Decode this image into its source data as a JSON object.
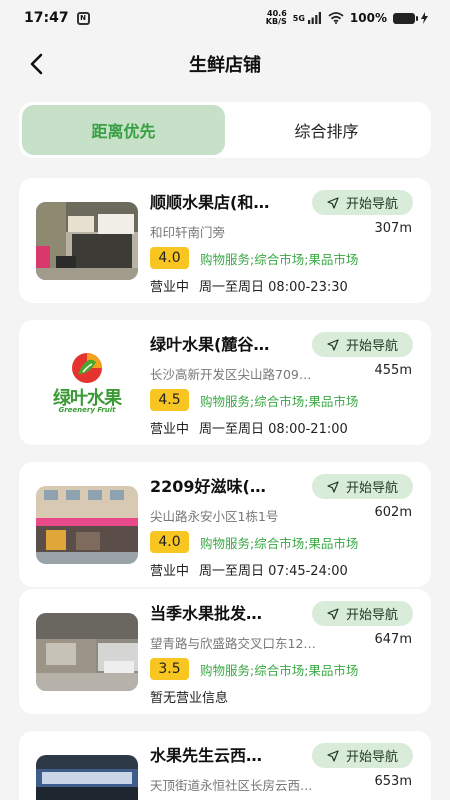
{
  "status_bar": {
    "time": "17:47",
    "net_speed_value": "40.6",
    "net_speed_unit": "KB/S",
    "network": "5G",
    "battery": "100%"
  },
  "header": {
    "title": "生鲜店铺"
  },
  "tabs": [
    {
      "label": "距离优先",
      "active": true
    },
    {
      "label": "综合排序",
      "active": false
    }
  ],
  "nav_label": "开始导航",
  "shops": [
    {
      "name": "顺顺水果店(和…",
      "address": "和印轩南门旁",
      "distance": "307m",
      "rating": "4.0",
      "category": "购物服务;综合市场;果品市场",
      "status": "营业中",
      "hours": "周一至周日 08:00-23:30"
    },
    {
      "name": "绿叶水果(麓谷…",
      "address": "长沙高新开发区尖山路709…",
      "distance": "455m",
      "rating": "4.5",
      "category": "购物服务;综合市场;果品市场",
      "status": "营业中",
      "hours": "周一至周日 08:00-21:00",
      "logo_text": "绿叶水果",
      "logo_sub": "Greenery Fruit"
    },
    {
      "name": "2209好滋味(…",
      "address": "尖山路永安小区1栋1号",
      "distance": "602m",
      "rating": "4.0",
      "category": "购物服务;综合市场;果品市场",
      "status": "营业中",
      "hours": "周一至周日 07:45-24:00"
    },
    {
      "name": "当季水果批发…",
      "address": "望青路与欣盛路交叉口东12…",
      "distance": "647m",
      "rating": "3.5",
      "category": "购物服务;综合市场;果品市场",
      "status": "暂无营业信息",
      "hours": ""
    },
    {
      "name": "水果先生云西…",
      "address": "天顶街道永恒社区长房云西…",
      "distance": "653m",
      "rating": "",
      "category": "",
      "status": "",
      "hours": ""
    }
  ],
  "colors": {
    "accent_green": "#3aa844",
    "tab_active_bg": "#c7e1c9",
    "nav_btn_bg": "#d9ebd9",
    "rating_bg": "#f8c521"
  }
}
